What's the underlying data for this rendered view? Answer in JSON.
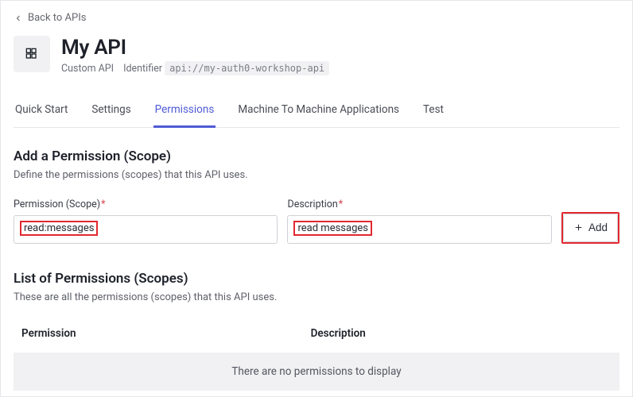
{
  "back": {
    "label": "Back to APIs"
  },
  "header": {
    "title": "My API",
    "type": "Custom API",
    "identifier_label": "Identifier",
    "identifier_value": "api://my-auth0-workshop-api"
  },
  "tabs": [
    "Quick Start",
    "Settings",
    "Permissions",
    "Machine To Machine Applications",
    "Test"
  ],
  "active_tab_index": 2,
  "add_section": {
    "title": "Add a Permission (Scope)",
    "desc": "Define the permissions (scopes) that this API uses.",
    "perm_label": "Permission (Scope)",
    "perm_value": "read:messages",
    "desc_label": "Description",
    "desc_value": "read messages",
    "add_label": "Add"
  },
  "list_section": {
    "title": "List of Permissions (Scopes)",
    "desc": "These are all the permissions (scopes) that this API uses.",
    "col_perm": "Permission",
    "col_desc": "Description",
    "empty": "There are no permissions to display"
  }
}
